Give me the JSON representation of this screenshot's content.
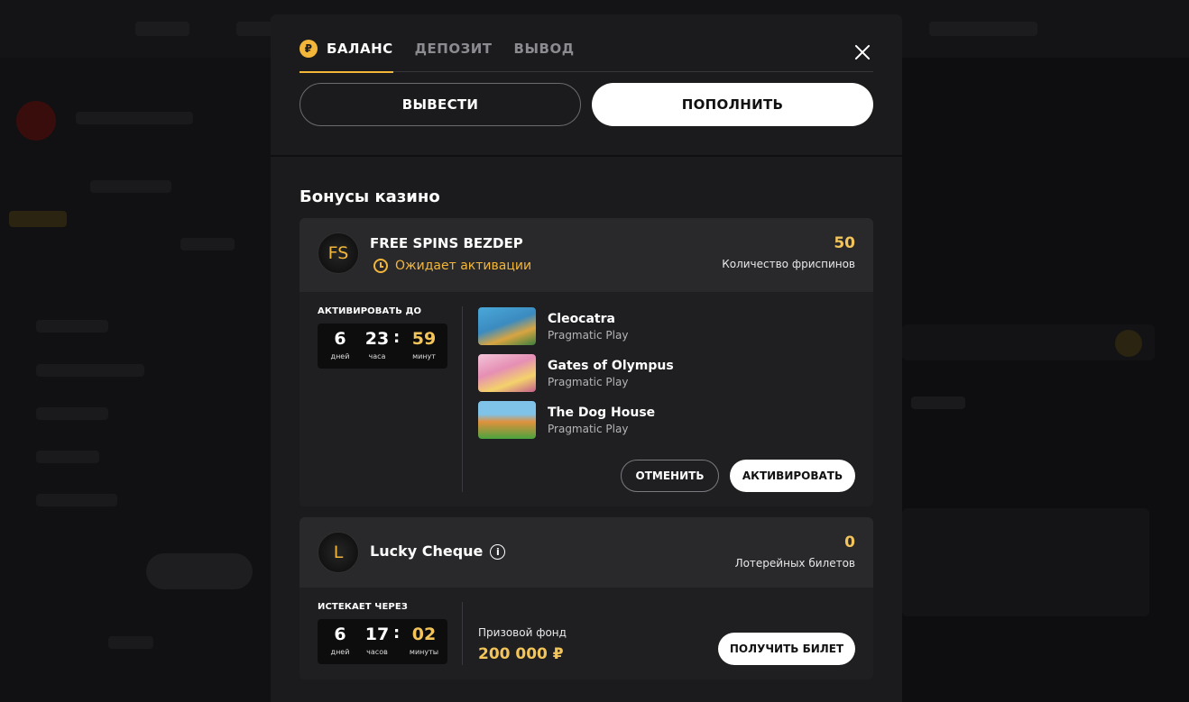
{
  "tabs": [
    {
      "label": "БАЛАНС",
      "active": true,
      "icon": "ruble-coin-icon",
      "icon_glyph": "₽"
    },
    {
      "label": "ДЕПОЗИТ",
      "active": false
    },
    {
      "label": "ВЫВОД",
      "active": false
    }
  ],
  "actions": {
    "withdraw_label": "ВЫВЕСТИ",
    "deposit_label": "ПОПОЛНИТЬ"
  },
  "section_title": "Бонусы казино",
  "bonus_freespins": {
    "avatar": "FS",
    "title": "FREE SPINS BEZDEP",
    "status": "Ожидает активации",
    "count": "50",
    "count_label": "Количество фриспинов",
    "deadline_label": "АКТИВИРОВАТЬ ДО",
    "timer": {
      "days": "6",
      "days_unit": "дней",
      "hours": "23",
      "hours_unit": "часа",
      "sep": ":",
      "minutes": "59",
      "minutes_unit": "минут"
    },
    "games": [
      {
        "name": "Cleocatra",
        "provider": "Pragmatic Play"
      },
      {
        "name": "Gates of Olympus",
        "provider": "Pragmatic Play"
      },
      {
        "name": "The Dog House",
        "provider": "Pragmatic Play"
      }
    ],
    "cancel_label": "ОТМЕНИТЬ",
    "activate_label": "АКТИВИРОВАТЬ"
  },
  "bonus_lottery": {
    "avatar": "L",
    "title": "Lucky Cheque",
    "info_glyph": "i",
    "count": "0",
    "count_label": "Лотерейных билетов",
    "expires_label": "ИСТЕКАЕТ ЧЕРЕЗ",
    "timer": {
      "days": "6",
      "days_unit": "дней",
      "hours": "17",
      "hours_unit": "часов",
      "sep": ":",
      "minutes": "02",
      "minutes_unit": "минуты"
    },
    "prize_label": "Призовой фонд",
    "prize_value": "200 000 ₽",
    "ticket_label": "ПОЛУЧИТЬ БИЛЕТ"
  },
  "colors": {
    "accent": "#f2b63a",
    "modal_bg": "#1b1b1d",
    "card_bg": "#1f1f22",
    "card_head_bg": "#29292c"
  }
}
